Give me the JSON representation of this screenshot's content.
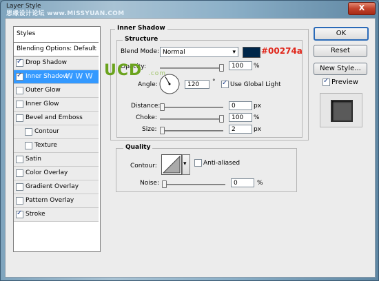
{
  "window": {
    "title": "Layer Style",
    "watermark": "思缘设计论坛  www.MISSYUAN.COM",
    "close_label": "X"
  },
  "styles_panel": {
    "header": "Styles",
    "blending_options": "Blending Options: Default",
    "items": [
      {
        "label": "Drop Shadow",
        "checked": true,
        "selected": false,
        "indent": false
      },
      {
        "label": "Inner Shadow",
        "checked": true,
        "selected": true,
        "indent": false
      },
      {
        "label": "Outer Glow",
        "checked": false,
        "selected": false,
        "indent": false
      },
      {
        "label": "Inner Glow",
        "checked": false,
        "selected": false,
        "indent": false
      },
      {
        "label": "Bevel and Emboss",
        "checked": false,
        "selected": false,
        "indent": false
      },
      {
        "label": "Contour",
        "checked": false,
        "selected": false,
        "indent": true
      },
      {
        "label": "Texture",
        "checked": false,
        "selected": false,
        "indent": true
      },
      {
        "label": "Satin",
        "checked": false,
        "selected": false,
        "indent": false
      },
      {
        "label": "Color Overlay",
        "checked": false,
        "selected": false,
        "indent": false
      },
      {
        "label": "Gradient Overlay",
        "checked": false,
        "selected": false,
        "indent": false
      },
      {
        "label": "Pattern Overlay",
        "checked": false,
        "selected": false,
        "indent": false
      },
      {
        "label": "Stroke",
        "checked": true,
        "selected": false,
        "indent": false
      }
    ],
    "overlay_text": "W W W"
  },
  "inner_shadow": {
    "section_title": "Inner Shadow",
    "structure_title": "Structure",
    "blend_mode_label": "Blend Mode:",
    "blend_mode_value": "Normal",
    "shadow_color": "#00274a",
    "color_annotation": "#00274a",
    "opacity_label": "Opacity:",
    "opacity_value": "100",
    "angle_label": "Angle:",
    "angle_value": "120",
    "angle_unit": "°",
    "use_global_light_label": "Use Global Light",
    "use_global_light": true,
    "distance_label": "Distance:",
    "distance_value": "0",
    "choke_label": "Choke:",
    "choke_value": "100",
    "size_label": "Size:",
    "size_value": "2",
    "unit_px": "px",
    "unit_pct": "%",
    "opacity_fraction": 1.0,
    "distance_fraction": 0.0,
    "choke_fraction": 1.0,
    "size_fraction": 0.0
  },
  "quality": {
    "title": "Quality",
    "contour_label": "Contour:",
    "anti_aliased_label": "Anti-aliased",
    "anti_aliased": false,
    "noise_label": "Noise:",
    "noise_value": "0",
    "unit_pct": "%",
    "noise_fraction": 0.0
  },
  "buttons": {
    "ok": "OK",
    "reset": "Reset",
    "new_style": "New Style...",
    "preview_label": "Preview",
    "preview_checked": true
  },
  "branding": {
    "logo_text": "UCD",
    "logo_sub": ".com"
  },
  "colors": {
    "selection": "#3399ff",
    "accent_green": "#6aa31d",
    "annotation_red": "#e0261a"
  }
}
